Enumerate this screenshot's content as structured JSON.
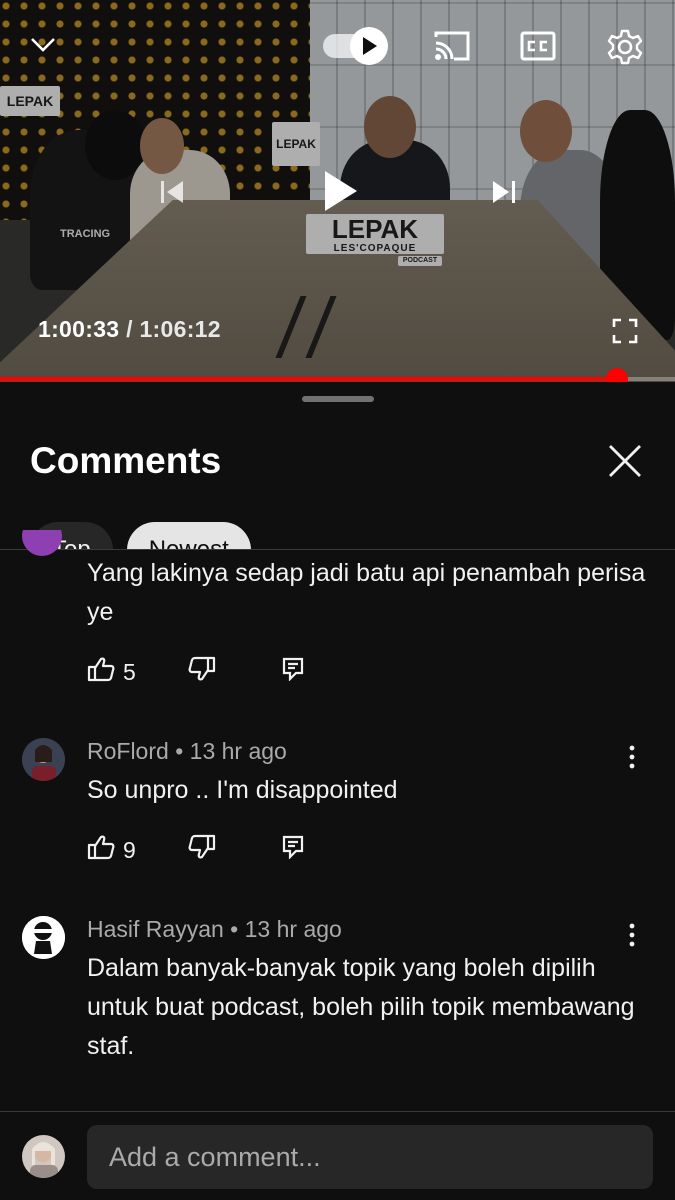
{
  "player": {
    "current_time": "1:00:33",
    "separator": " / ",
    "duration": "1:06:12",
    "progress_fraction": 0.914,
    "autoplay_on": true,
    "scene_signs": [
      "LEPAK",
      "LEPAK",
      "LEPAK",
      "LES'COPAQUE",
      "PODCAST",
      "TRACING"
    ]
  },
  "panel": {
    "title": "Comments",
    "chips": [
      "Top",
      "Newest"
    ]
  },
  "comments": [
    {
      "text": "Yang lakinya sedap jadi batu api penambah perisa ye",
      "likes": "5"
    },
    {
      "author": "RoFlord",
      "dot": "•",
      "time": "13 hr ago",
      "text": "So unpro .. I'm disappointed",
      "likes": "9"
    },
    {
      "author": "Hasif Rayyan",
      "dot": "•",
      "time": "13 hr ago",
      "text": "Dalam banyak-banyak topik yang boleh dipilih untuk buat podcast, boleh pilih topik membawang staf."
    }
  ],
  "add_comment": {
    "placeholder": "Add a comment..."
  },
  "colors": {
    "accent": "#ff0000",
    "background": "#0f0f0f",
    "text_secondary": "#aaaaaa",
    "avatar_purple": "#8e3fb2"
  },
  "icons": [
    "chevron-down-icon",
    "autoplay-toggle-icon",
    "cast-icon",
    "captions-icon",
    "gear-icon",
    "previous-icon",
    "play-icon",
    "next-icon",
    "fullscreen-icon",
    "close-icon",
    "thumb-up-icon",
    "thumb-down-icon",
    "reply-icon",
    "more-vert-icon"
  ]
}
